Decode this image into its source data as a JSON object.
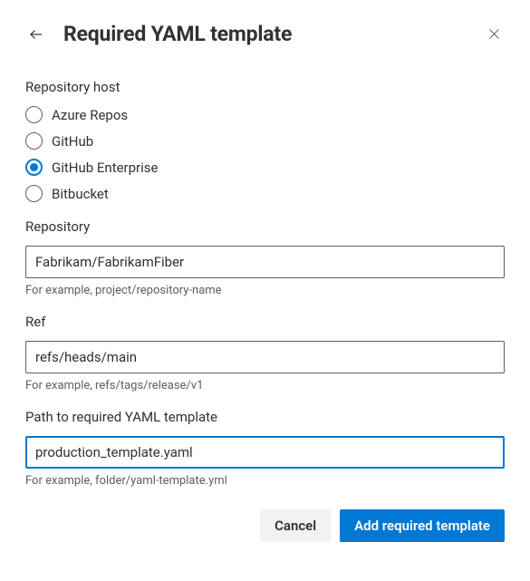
{
  "header": {
    "title": "Required YAML template"
  },
  "hostSection": {
    "label": "Repository host",
    "options": [
      {
        "label": "Azure Repos",
        "selected": false
      },
      {
        "label": "GitHub",
        "selected": false
      },
      {
        "label": "GitHub Enterprise",
        "selected": true
      },
      {
        "label": "Bitbucket",
        "selected": false
      }
    ]
  },
  "repository": {
    "label": "Repository",
    "value": "Fabrikam/FabrikamFiber",
    "hint": "For example, project/repository-name"
  },
  "ref": {
    "label": "Ref",
    "value": "refs/heads/main",
    "hint": "For example, refs/tags/release/v1"
  },
  "path": {
    "label": "Path to required YAML template",
    "value": "production_template.yaml",
    "hint": "For example, folder/yaml-template.yml"
  },
  "buttons": {
    "cancel": "Cancel",
    "submit": "Add required template"
  }
}
